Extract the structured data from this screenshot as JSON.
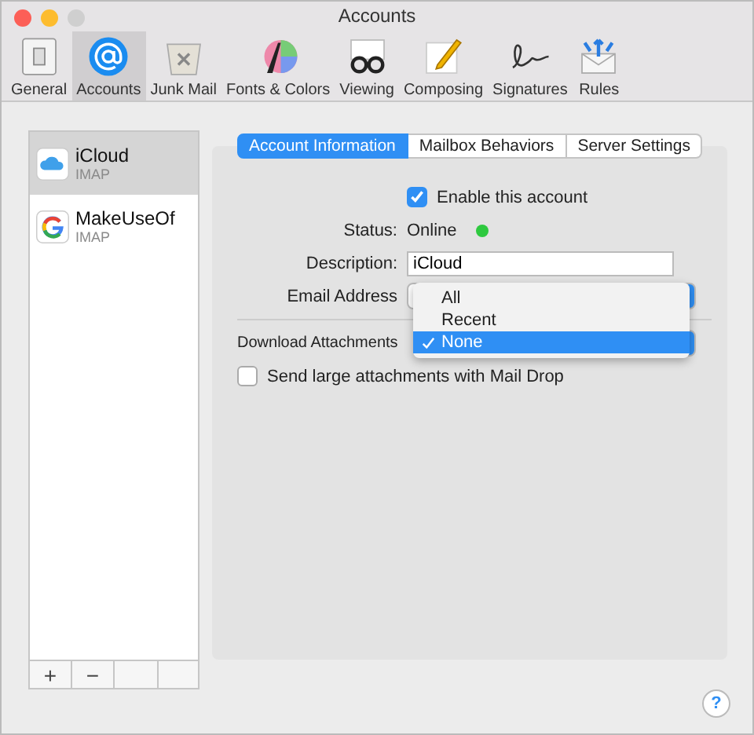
{
  "window": {
    "title": "Accounts"
  },
  "toolbar": [
    {
      "label": "General",
      "kind": "general",
      "selected": false
    },
    {
      "label": "Accounts",
      "kind": "accounts",
      "selected": true
    },
    {
      "label": "Junk Mail",
      "kind": "junk",
      "selected": false
    },
    {
      "label": "Fonts & Colors",
      "kind": "fonts",
      "selected": false
    },
    {
      "label": "Viewing",
      "kind": "viewing",
      "selected": false
    },
    {
      "label": "Composing",
      "kind": "composing",
      "selected": false
    },
    {
      "label": "Signatures",
      "kind": "signatures",
      "selected": false
    },
    {
      "label": "Rules",
      "kind": "rules",
      "selected": false
    }
  ],
  "accounts": [
    {
      "name": "iCloud",
      "type": "IMAP",
      "kind": "cloud",
      "selected": true
    },
    {
      "name": "MakeUseOf",
      "type": "IMAP",
      "kind": "google",
      "selected": false
    }
  ],
  "list_buttons": [
    "+",
    "−"
  ],
  "tabs": [
    {
      "label": "Account Information",
      "selected": true
    },
    {
      "label": "Mailbox Behaviors",
      "selected": false
    },
    {
      "label": "Server Settings",
      "selected": false
    }
  ],
  "form": {
    "enable": {
      "label": "Enable this account",
      "checked": true
    },
    "status": {
      "label": "Status:",
      "value": "Online",
      "online": true
    },
    "description": {
      "label": "Description:",
      "value": "iCloud"
    },
    "email_address": {
      "label": "Email Address"
    },
    "download_attachments": {
      "label": "Download Attachments"
    },
    "mail_drop": {
      "label": "Send large attachments with Mail Drop",
      "checked": false
    }
  },
  "menu": [
    {
      "label": "All",
      "selected": false
    },
    {
      "label": "Recent",
      "selected": false
    },
    {
      "label": "None",
      "selected": true
    }
  ],
  "help": "?"
}
